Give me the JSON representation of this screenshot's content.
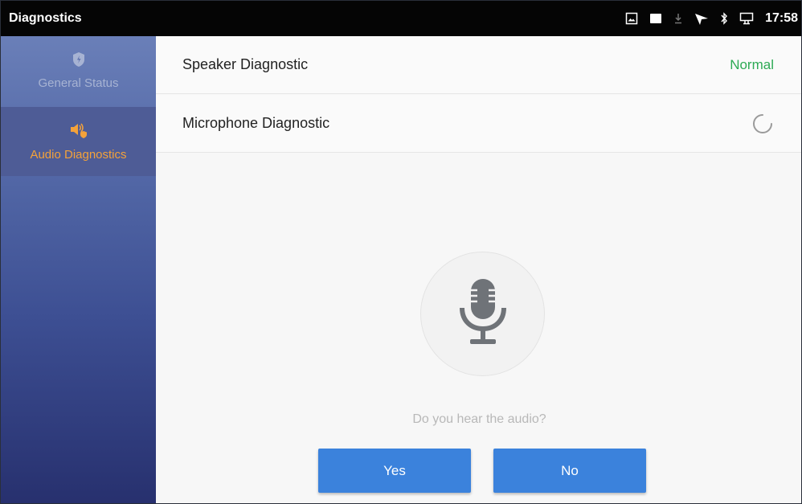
{
  "statusbar": {
    "title": "Diagnostics",
    "time": "17:58",
    "icons": [
      "screenshot-icon",
      "notification-box-icon",
      "download-icon",
      "signal-icon",
      "bluetooth-icon",
      "display-icon"
    ]
  },
  "sidebar": {
    "items": [
      {
        "label": "General Status",
        "icon": "shield-bolt-icon",
        "selected": false
      },
      {
        "label": "Audio Diagnostics",
        "icon": "speaker-shield-icon",
        "selected": true
      }
    ]
  },
  "main": {
    "speaker": {
      "label": "Speaker Diagnostic",
      "status": "Normal"
    },
    "microphone": {
      "label": "Microphone Diagnostic",
      "status_icon": "loading-spinner-icon"
    },
    "question": "Do you hear the audio?",
    "yes_label": "Yes",
    "no_label": "No"
  },
  "colors": {
    "accent": "#f4a23a",
    "normal_status": "#2eaa55",
    "button": "#3b82dc"
  }
}
